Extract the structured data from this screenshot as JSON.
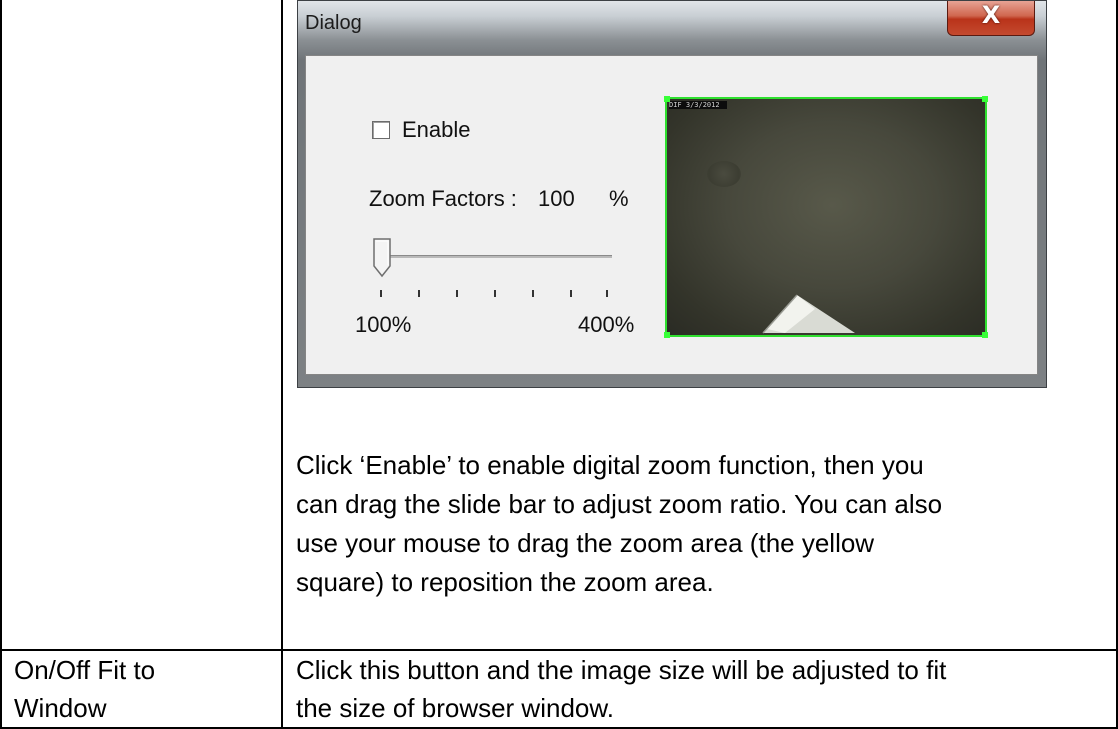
{
  "dialog": {
    "title": "Dialog",
    "close_glyph": "X",
    "enable_label": "Enable",
    "enable_checked": false,
    "zoom_label": "Zoom Factors :",
    "zoom_value": "100",
    "zoom_unit": "%",
    "slider_value_fraction": 0.0,
    "slider_min_label": "100%",
    "slider_max_label": "400%",
    "preview_stamp": "DIF 3/3/2012",
    "preview_border_color": "#2fe02f"
  },
  "description": {
    "lines": [
      "Click ‘Enable’ to enable digital zoom function, then you",
      "can drag the slide bar to adjust zoom ratio. You can also",
      "use your mouse to drag the zoom area (the yellow",
      "square) to reposition the zoom area."
    ]
  },
  "row2": {
    "label_lines": [
      "On/Off Fit to",
      "Window"
    ],
    "text_lines": [
      "Click this button and the image size will be adjusted to fit",
      "the size of browser window."
    ]
  }
}
